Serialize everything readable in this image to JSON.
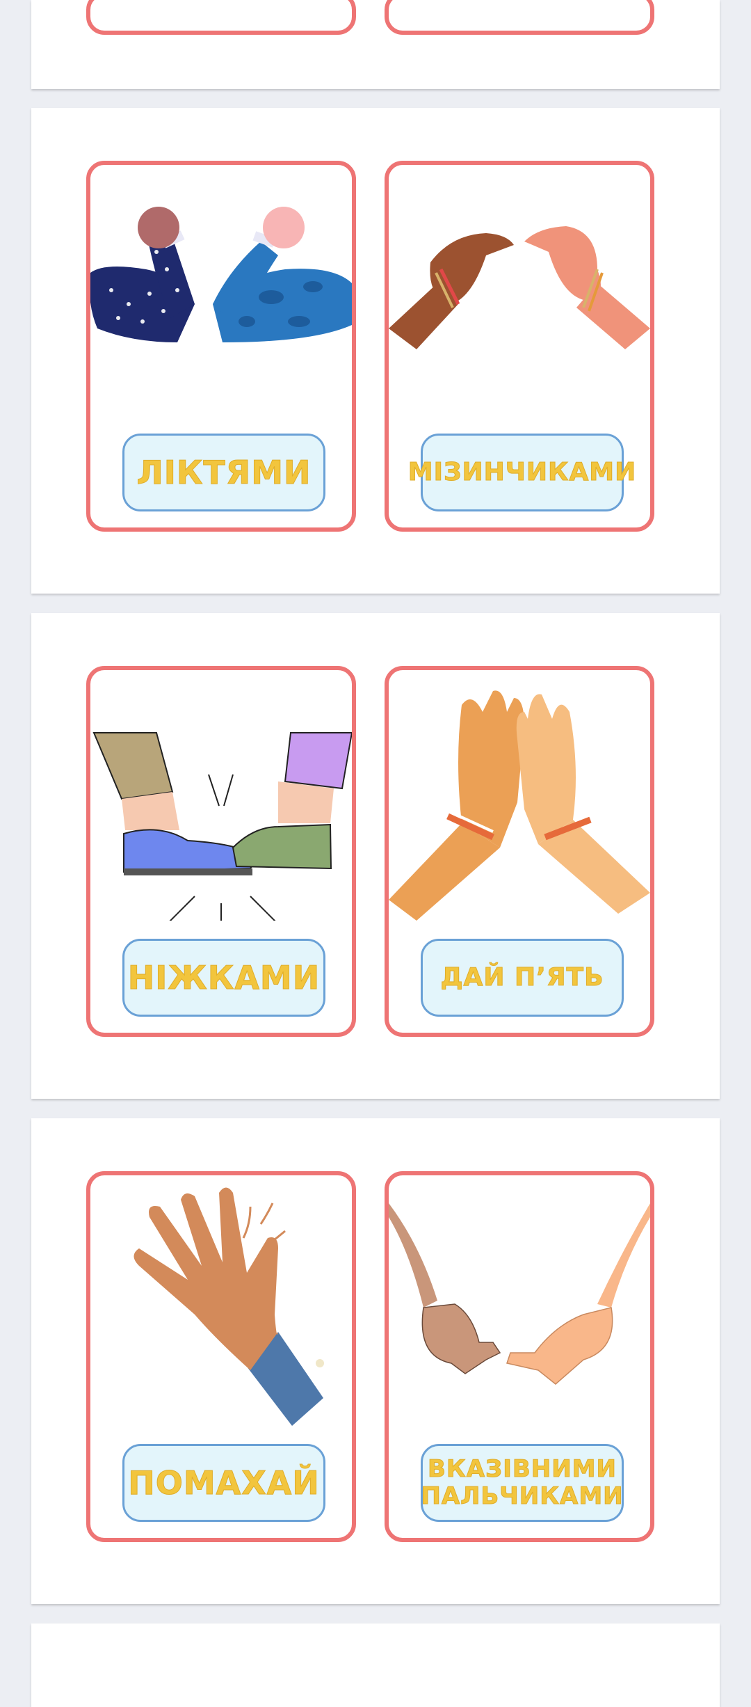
{
  "sheets": [
    {
      "cards": [
        {
          "label": ""
        },
        {
          "label": ""
        }
      ]
    },
    {
      "cards": [
        {
          "label": "ЛІКТЯМИ",
          "icon": "elbows-icon"
        },
        {
          "label": "МІЗИНЧИКАМИ",
          "icon": "pinkies-icon"
        }
      ]
    },
    {
      "cards": [
        {
          "label": "НІЖКАМИ",
          "icon": "feet-icon"
        },
        {
          "label": "ДАЙ П’ЯТЬ",
          "icon": "high-five-icon"
        }
      ]
    },
    {
      "cards": [
        {
          "label": "ПОМАХАЙ",
          "icon": "wave-hand-icon"
        },
        {
          "label": "ВКАЗІВНИМИ ПАЛЬЧИКАМИ",
          "icon": "index-fingers-icon"
        }
      ]
    }
  ],
  "colors": {
    "card_border": "#ee7474",
    "label_bg": "#e3f5fb",
    "label_border": "#6aa1d6",
    "label_text": "#f2c53d",
    "background": "#eceef3"
  }
}
